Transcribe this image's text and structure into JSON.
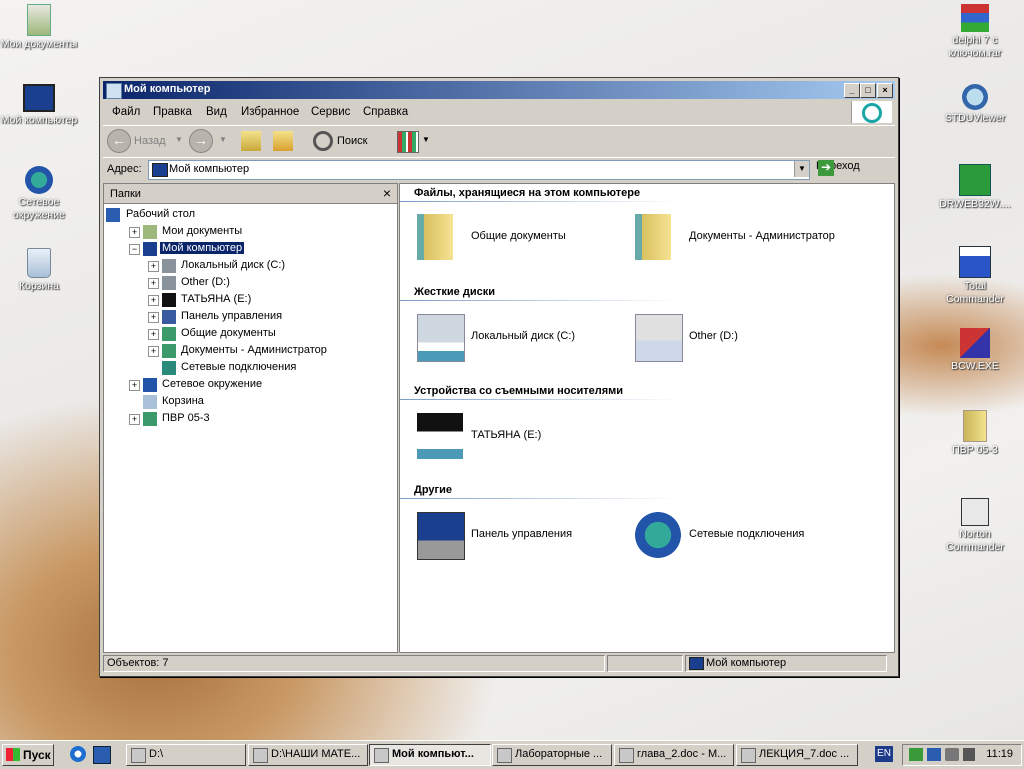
{
  "desktop": {
    "left_icons": [
      {
        "label": "Мои документы",
        "icon": "my-documents-icon"
      },
      {
        "label": "Мой компьютер",
        "icon": "my-computer-icon"
      },
      {
        "label": "Сетевое окружение",
        "icon": "network-icon"
      },
      {
        "label": "Корзина",
        "icon": "recycle-bin-icon"
      }
    ],
    "right_icons": [
      {
        "label": "delphi 7 с ключом.rar",
        "icon": "rar-archive-icon"
      },
      {
        "label": "STDUViewer",
        "icon": "stdu-viewer-icon"
      },
      {
        "label": "DRWEB32W....",
        "icon": "drweb-icon"
      },
      {
        "label": "Total Commander",
        "icon": "total-commander-icon"
      },
      {
        "label": "BCW.EXE",
        "icon": "bcw-exe-icon"
      },
      {
        "label": "ПВР 05-3",
        "icon": "folder-icon"
      },
      {
        "label": "Norton Commander",
        "icon": "norton-commander-icon"
      }
    ]
  },
  "window": {
    "title": "Мой компьютер",
    "menu": [
      "Файл",
      "Правка",
      "Вид",
      "Избранное",
      "Сервис",
      "Справка"
    ],
    "toolbar": {
      "back": "Назад",
      "search": "Поиск"
    },
    "address": {
      "label": "Адрес:",
      "value": "Мой компьютер",
      "go": "Переход"
    },
    "folders_pane": {
      "title": "Папки",
      "tree": [
        {
          "label": "Рабочий стол",
          "level": 0,
          "expander": "",
          "icon": "desktop-icon"
        },
        {
          "label": "Мои документы",
          "level": 1,
          "expander": "+",
          "icon": "my-documents-icon"
        },
        {
          "label": "Мой компьютер",
          "level": 1,
          "expander": "−",
          "icon": "my-computer-icon",
          "selected": true
        },
        {
          "label": "Локальный диск (C:)",
          "level": 2,
          "expander": "+",
          "icon": "hard-drive-icon"
        },
        {
          "label": "Other (D:)",
          "level": 2,
          "expander": "+",
          "icon": "hard-drive-icon"
        },
        {
          "label": "ТАТЬЯНА (E:)",
          "level": 2,
          "expander": "+",
          "icon": "usb-drive-icon"
        },
        {
          "label": "Панель управления",
          "level": 2,
          "expander": "+",
          "icon": "control-panel-icon"
        },
        {
          "label": "Общие документы",
          "level": 2,
          "expander": "+",
          "icon": "folder-icon"
        },
        {
          "label": "Документы - Администратор",
          "level": 2,
          "expander": "+",
          "icon": "folder-icon"
        },
        {
          "label": "Сетевые подключения",
          "level": 2,
          "expander": "",
          "icon": "network-connections-icon"
        },
        {
          "label": "Сетевое окружение",
          "level": 1,
          "expander": "+",
          "icon": "network-icon"
        },
        {
          "label": "Корзина",
          "level": 1,
          "expander": "",
          "icon": "recycle-bin-icon"
        },
        {
          "label": "ПВР 05-3",
          "level": 1,
          "expander": "+",
          "icon": "folder-icon"
        }
      ]
    },
    "content": {
      "sections": [
        {
          "title": "Файлы, хранящиеся на этом компьютере",
          "items": [
            {
              "label": "Общие документы",
              "icon": "folder-icon"
            },
            {
              "label": "Документы - Администратор",
              "icon": "folder-icon"
            }
          ]
        },
        {
          "title": "Жесткие диски",
          "items": [
            {
              "label": "Локальный диск (C:)",
              "icon": "hard-drive-icon"
            },
            {
              "label": "Other (D:)",
              "icon": "shared-drive-icon"
            }
          ]
        },
        {
          "title": "Устройства со съемными носителями",
          "items": [
            {
              "label": "ТАТЬЯНА (E:)",
              "icon": "usb-drive-icon"
            }
          ]
        },
        {
          "title": "Другие",
          "items": [
            {
              "label": "Панель управления",
              "icon": "control-panel-icon"
            },
            {
              "label": "Сетевые подключения",
              "icon": "network-connections-icon"
            }
          ]
        }
      ]
    },
    "status": {
      "objects": "Объектов: 7",
      "location": "Мой компьютер"
    }
  },
  "taskbar": {
    "start": "Пуск",
    "tasks": [
      {
        "label": "D:\\",
        "active": false
      },
      {
        "label": "D:\\НАШИ МАТЕ...",
        "active": false
      },
      {
        "label": "Мой компьют...",
        "active": true
      },
      {
        "label": "Лабораторные ...",
        "active": false
      },
      {
        "label": "глава_2.doc - M...",
        "active": false
      },
      {
        "label": "ЛЕКЦИЯ_7.doc ...",
        "active": false
      }
    ],
    "language": "EN",
    "clock": "11:19"
  }
}
